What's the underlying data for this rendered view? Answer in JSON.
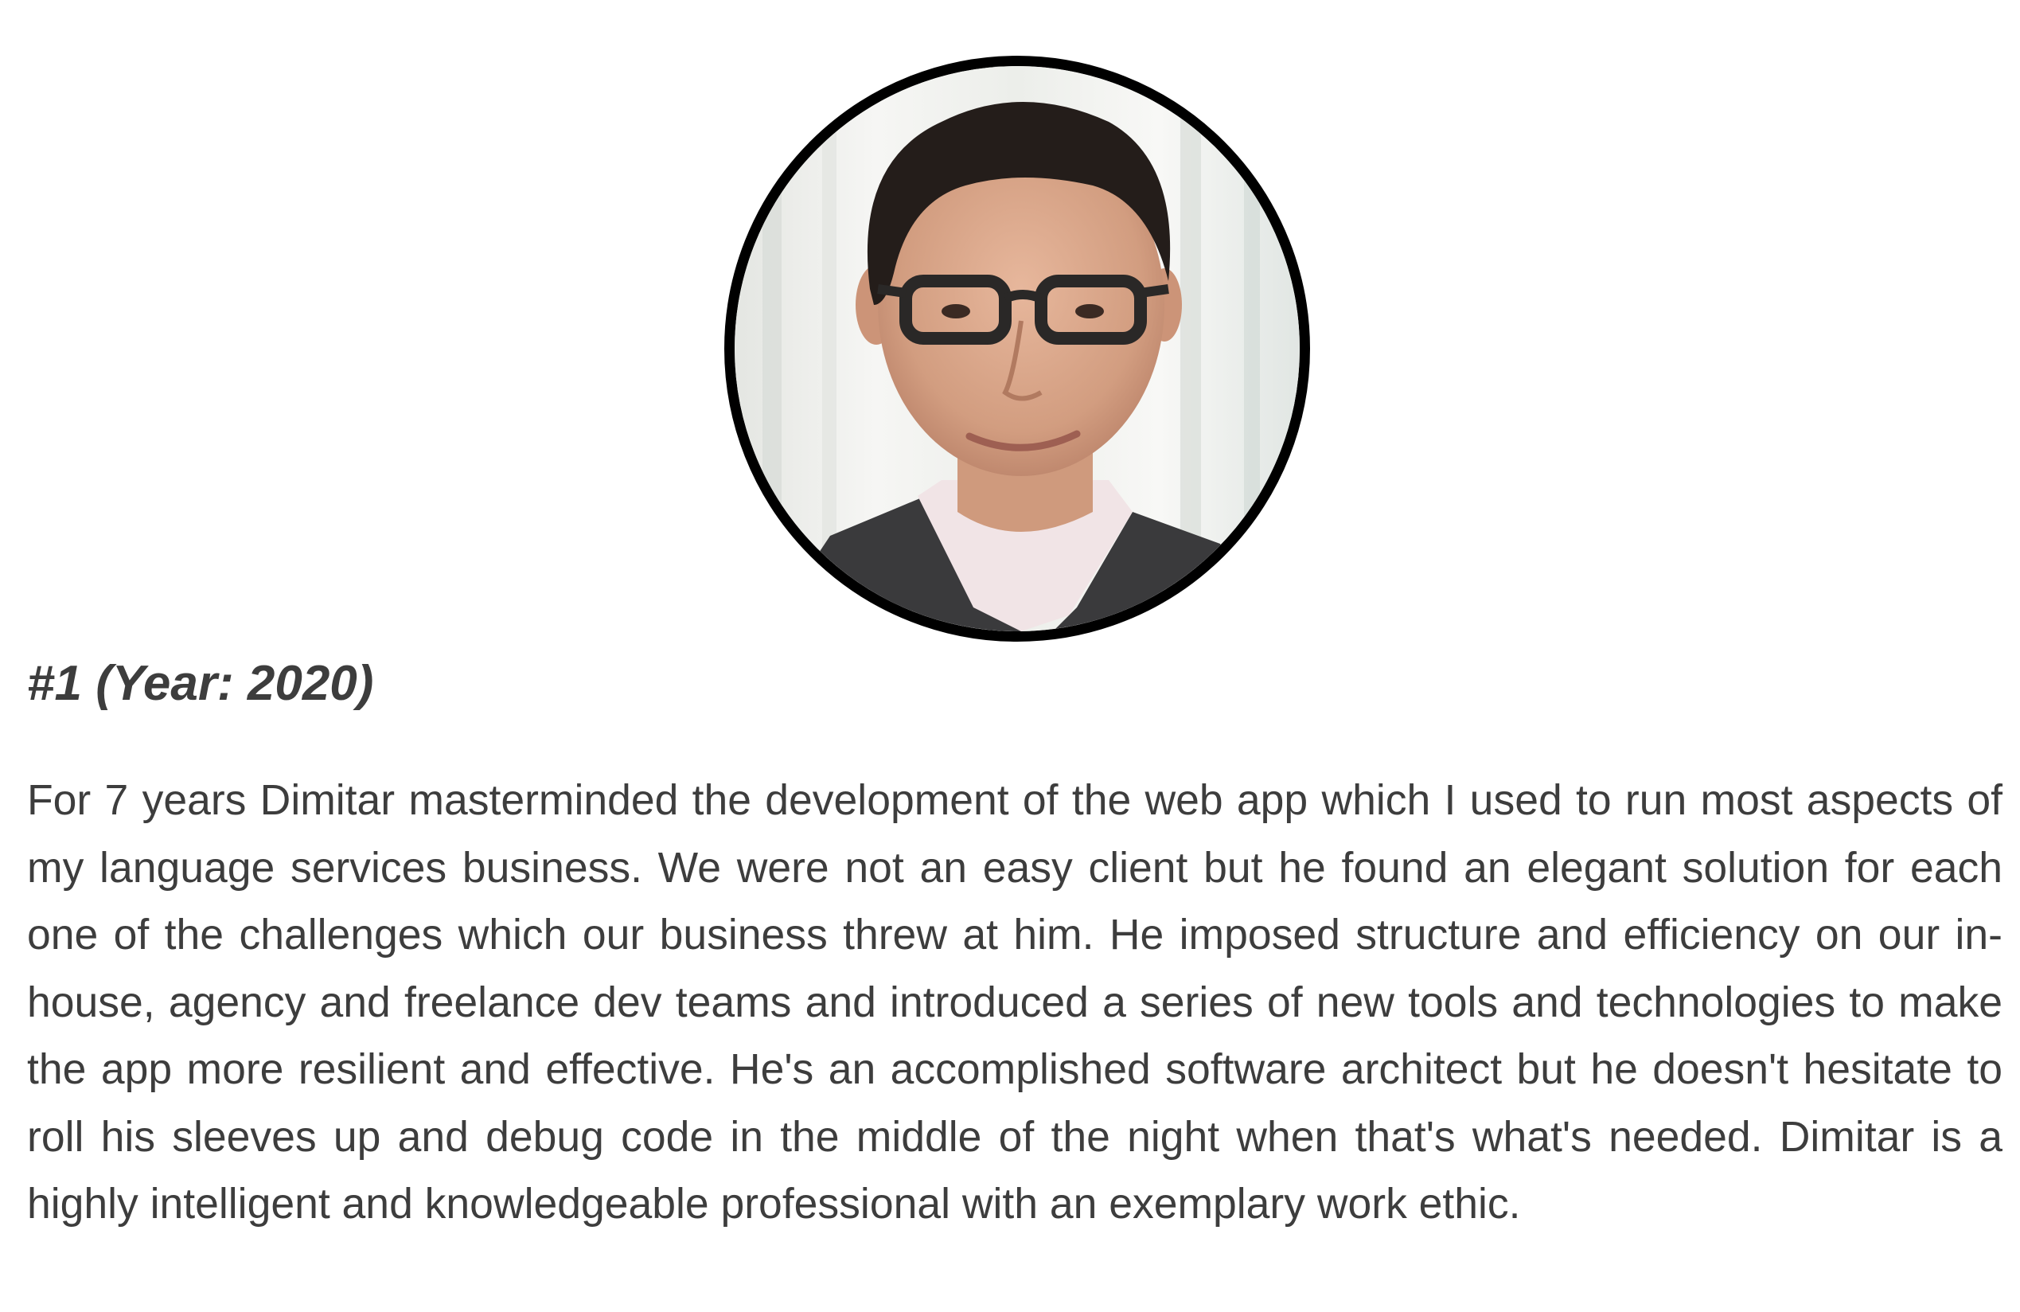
{
  "testimonial": {
    "avatar": {
      "icon": "person-portrait-photo",
      "border_color": "#000000"
    },
    "title": "#1 (Year: 2020)",
    "quote": "For 7 years Dimitar masterminded the development of the web app which I used to run most aspects of my language services business. We were not an easy client but he found an elegant solution for each one of the challenges which our business threw at him. He imposed structure and efficiency on our in-house, agency and freelance dev teams and introduced a series of new tools and technologies to make the app more resilient and effective. He's an accomplished software architect but he doesn't hesitate to roll his sleeves up and debug code in the middle of the night when that's what's needed. Dimitar is a highly intelligent and knowledgeable professional with an exemplary work ethic.",
    "text_color": "#3d3d3d"
  }
}
